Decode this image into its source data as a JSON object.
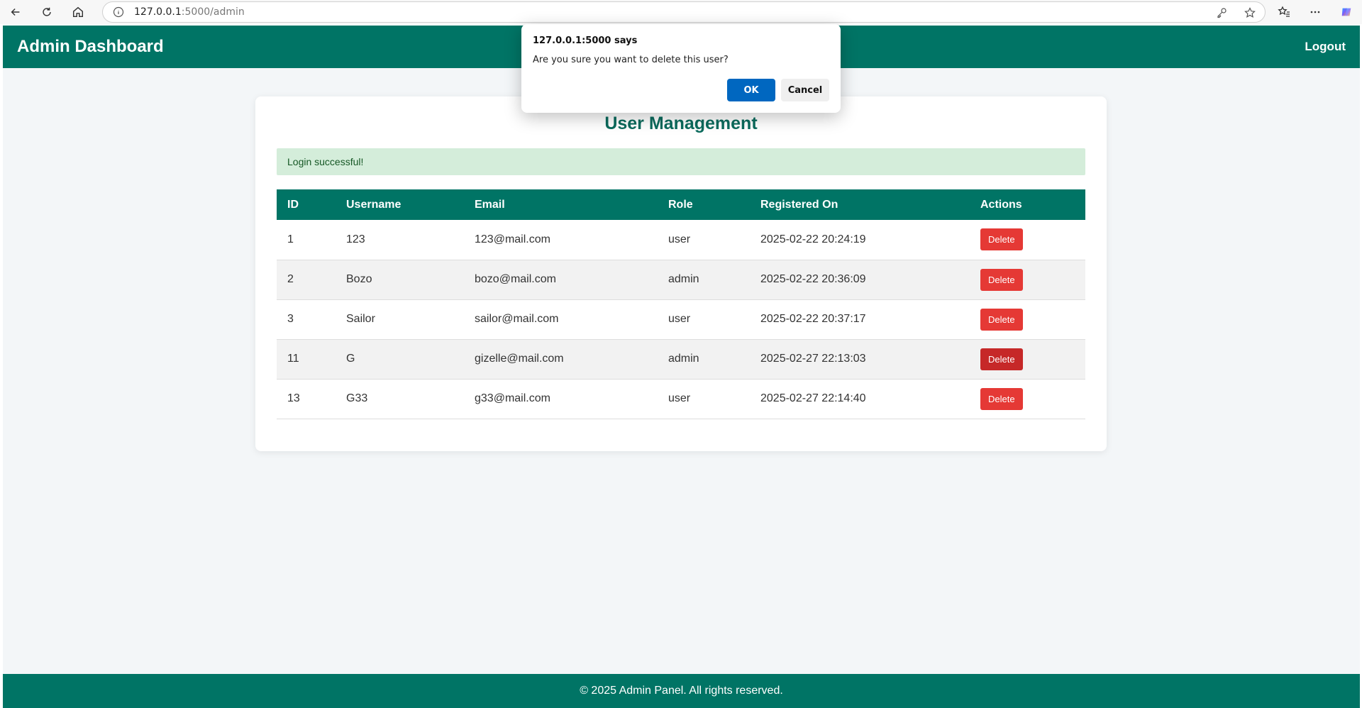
{
  "browser": {
    "url_host": "127.0.0.1",
    "url_path": ":5000/admin"
  },
  "header": {
    "title": "Admin Dashboard",
    "logout_label": "Logout"
  },
  "main": {
    "title": "User Management",
    "alert": "Login successful!",
    "columns": [
      "ID",
      "Username",
      "Email",
      "Role",
      "Registered On",
      "Actions"
    ],
    "rows": [
      {
        "id": "1",
        "username": "123",
        "email": "123@mail.com",
        "role": "user",
        "registered": "2025-02-22 20:24:19",
        "action": "Delete"
      },
      {
        "id": "2",
        "username": "Bozo",
        "email": "bozo@mail.com",
        "role": "admin",
        "registered": "2025-02-22 20:36:09",
        "action": "Delete"
      },
      {
        "id": "3",
        "username": "Sailor",
        "email": "sailor@mail.com",
        "role": "user",
        "registered": "2025-02-22 20:37:17",
        "action": "Delete"
      },
      {
        "id": "11",
        "username": "G",
        "email": "gizelle@mail.com",
        "role": "admin",
        "registered": "2025-02-27 22:13:03",
        "action": "Delete"
      },
      {
        "id": "13",
        "username": "G33",
        "email": "g33@mail.com",
        "role": "user",
        "registered": "2025-02-27 22:14:40",
        "action": "Delete"
      }
    ]
  },
  "footer": {
    "text": "© 2025 Admin Panel. All rights reserved."
  },
  "dialog": {
    "title": "127.0.0.1:5000 says",
    "message": "Are you sure you want to delete this user?",
    "ok_label": "OK",
    "cancel_label": "Cancel"
  },
  "colors": {
    "primary": "#007465",
    "danger": "#e53935",
    "alert_bg": "#d4edda",
    "dialog_ok": "#0067c0"
  }
}
